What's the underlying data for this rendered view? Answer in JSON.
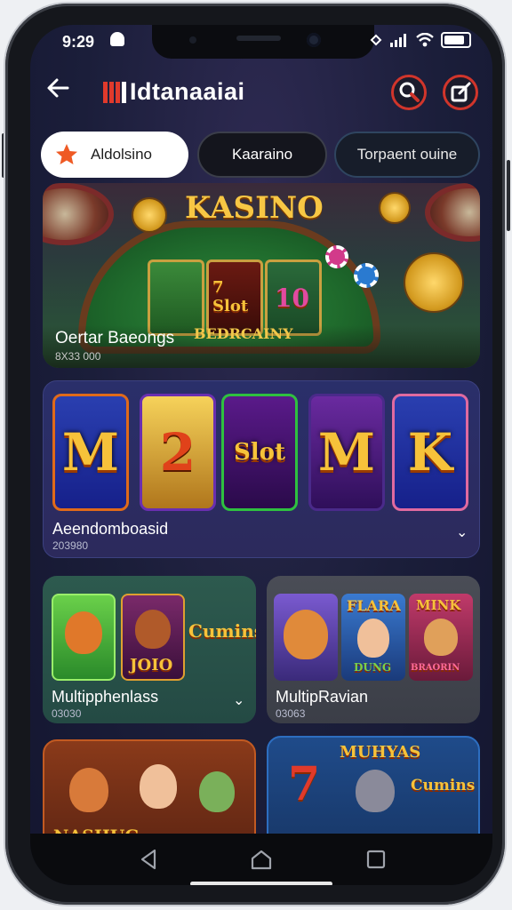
{
  "status": {
    "time": "9:29"
  },
  "appbar": {
    "brand": "Idtanaaiai"
  },
  "tabs": [
    {
      "label": "Aldolsino"
    },
    {
      "label": "Kaaraino"
    },
    {
      "label": "Torpaent ouine"
    }
  ],
  "banner": {
    "heading": "KASINO",
    "title": "Oertar Baeongs",
    "subtitle": "8X33 000",
    "center_label": "BEDRCAINY",
    "cards": [
      "7 Slot",
      "10"
    ]
  },
  "slots_panel": {
    "label": "Aeendomboasid",
    "subtitle": "203980",
    "tiles": [
      "M",
      "2",
      "Slot",
      "M",
      "K"
    ]
  },
  "multi_panel_left": {
    "label": "Multipphenlass",
    "subtitle": "03030",
    "thumb_texts": [
      "JOIO",
      "Cumins"
    ]
  },
  "multi_panel_right": {
    "label": "MultipRavian",
    "subtitle": "03063",
    "thumb_texts": [
      "FLARA",
      "MINK",
      "DUNG",
      "BRAORIN"
    ]
  },
  "bottom_left": {
    "label": "NASHUG"
  },
  "bottom_right": {
    "label": "MUHYAS",
    "badge_text": "Cumins",
    "digit": "7"
  },
  "colors": {
    "accent": "#d1352b",
    "gold": "#f6c23a",
    "background": "#1b1e3a"
  }
}
